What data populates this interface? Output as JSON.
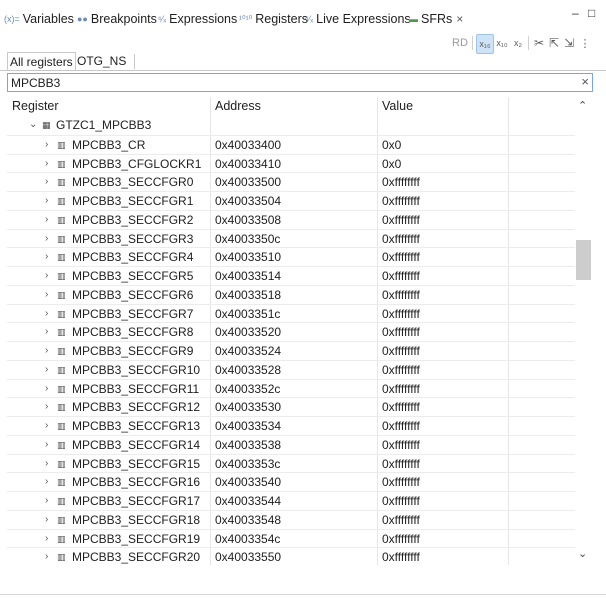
{
  "tabs": [
    {
      "icon": "(x)=",
      "label": "Variables"
    },
    {
      "icon": "●●",
      "label": "Breakpoints"
    },
    {
      "icon": "⁶⁄ₓ",
      "label": "Expressions"
    },
    {
      "icon": "¹⁰¹⁰",
      "label": "Registers"
    },
    {
      "icon": "⁶⁄ₓ",
      "label": "Live Expressions"
    },
    {
      "icon": "▬",
      "label": "SFRs",
      "close": "×"
    }
  ],
  "window_controls": {
    "minimize": "–",
    "maximize": "□"
  },
  "toolbar": {
    "rd": "RD",
    "hex": "x₁₆",
    "dec": "x₁₀",
    "bin": "x₂",
    "scissors": "✂",
    "export": "⇱",
    "import": "⇲",
    "more": "⋮"
  },
  "subtabs": [
    "All registers",
    "OTG_NS"
  ],
  "filter": {
    "value": "MPCBB3",
    "clear": "×"
  },
  "columns": {
    "register": "Register",
    "address": "Address",
    "value": "Value"
  },
  "group": {
    "name": "GTZC1_MPCBB3",
    "icon": "▦"
  },
  "rows": [
    {
      "name": "MPCBB3_CR",
      "address": "0x40033400",
      "value": "0x0"
    },
    {
      "name": "MPCBB3_CFGLOCKR1",
      "address": "0x40033410",
      "value": "0x0"
    },
    {
      "name": "MPCBB3_SECCFGR0",
      "address": "0x40033500",
      "value": "0xffffffff"
    },
    {
      "name": "MPCBB3_SECCFGR1",
      "address": "0x40033504",
      "value": "0xffffffff"
    },
    {
      "name": "MPCBB3_SECCFGR2",
      "address": "0x40033508",
      "value": "0xffffffff"
    },
    {
      "name": "MPCBB3_SECCFGR3",
      "address": "0x4003350c",
      "value": "0xffffffff"
    },
    {
      "name": "MPCBB3_SECCFGR4",
      "address": "0x40033510",
      "value": "0xffffffff"
    },
    {
      "name": "MPCBB3_SECCFGR5",
      "address": "0x40033514",
      "value": "0xffffffff"
    },
    {
      "name": "MPCBB3_SECCFGR6",
      "address": "0x40033518",
      "value": "0xffffffff"
    },
    {
      "name": "MPCBB3_SECCFGR7",
      "address": "0x4003351c",
      "value": "0xffffffff"
    },
    {
      "name": "MPCBB3_SECCFGR8",
      "address": "0x40033520",
      "value": "0xffffffff"
    },
    {
      "name": "MPCBB3_SECCFGR9",
      "address": "0x40033524",
      "value": "0xffffffff"
    },
    {
      "name": "MPCBB3_SECCFGR10",
      "address": "0x40033528",
      "value": "0xffffffff"
    },
    {
      "name": "MPCBB3_SECCFGR11",
      "address": "0x4003352c",
      "value": "0xffffffff"
    },
    {
      "name": "MPCBB3_SECCFGR12",
      "address": "0x40033530",
      "value": "0xffffffff"
    },
    {
      "name": "MPCBB3_SECCFGR13",
      "address": "0x40033534",
      "value": "0xffffffff"
    },
    {
      "name": "MPCBB3_SECCFGR14",
      "address": "0x40033538",
      "value": "0xffffffff"
    },
    {
      "name": "MPCBB3_SECCFGR15",
      "address": "0x4003353c",
      "value": "0xffffffff"
    },
    {
      "name": "MPCBB3_SECCFGR16",
      "address": "0x40033540",
      "value": "0xffffffff"
    },
    {
      "name": "MPCBB3_SECCFGR17",
      "address": "0x40033544",
      "value": "0xffffffff"
    },
    {
      "name": "MPCBB3_SECCFGR18",
      "address": "0x40033548",
      "value": "0xffffffff"
    },
    {
      "name": "MPCBB3_SECCFGR19",
      "address": "0x4003354c",
      "value": "0xffffffff"
    },
    {
      "name": "MPCBB3_SECCFGR20",
      "address": "0x40033550",
      "value": "0xffffffff"
    }
  ],
  "icons": {
    "expanded": "⌄",
    "collapsed": "›",
    "register": "▥",
    "scroll_up": "⌃",
    "scroll_down": "⌄"
  }
}
